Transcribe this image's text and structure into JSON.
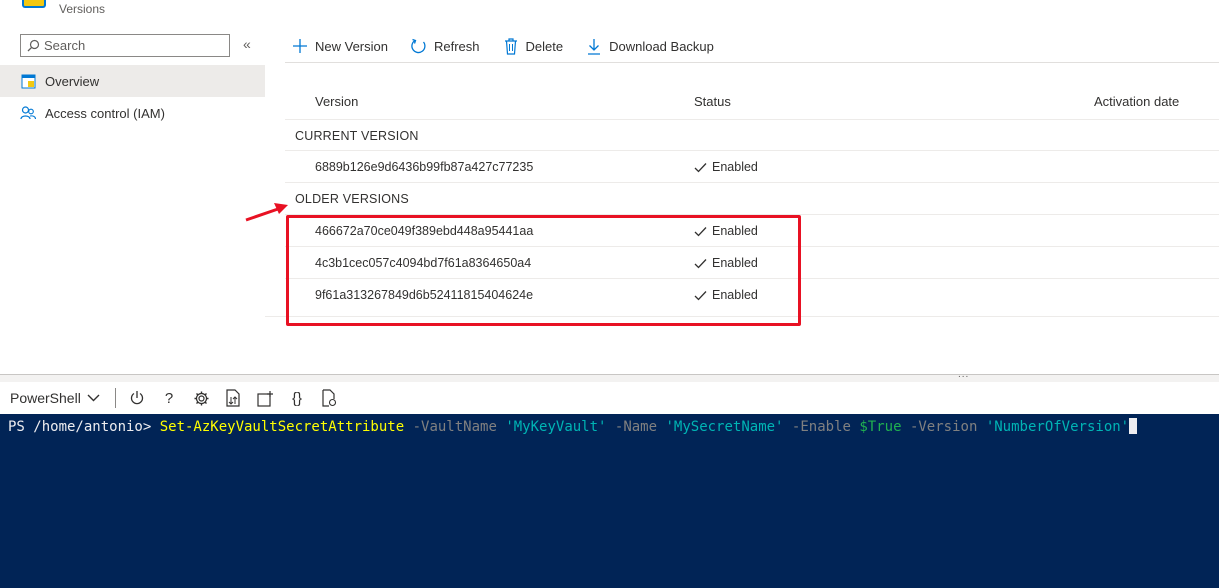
{
  "header": {
    "subtitle": "Versions"
  },
  "sidebar": {
    "search_placeholder": "Search",
    "collapse_glyph": "«",
    "items": [
      {
        "label": "Overview",
        "icon": "overview-icon",
        "active": true
      },
      {
        "label": "Access control (IAM)",
        "icon": "people-icon",
        "active": false
      }
    ]
  },
  "toolbar": {
    "new_version": "New Version",
    "refresh": "Refresh",
    "delete": "Delete",
    "download_backup": "Download Backup"
  },
  "table": {
    "columns": {
      "version": "Version",
      "status": "Status",
      "activation_date": "Activation date"
    },
    "current_section": "CURRENT VERSION",
    "current_rows": [
      {
        "version": "6889b126e9d6436b99fb87a427c77235",
        "status": "Enabled"
      }
    ],
    "older_section": "OLDER VERSIONS",
    "older_rows": [
      {
        "version": "466672a70ce049f389ebd448a95441aa",
        "status": "Enabled"
      },
      {
        "version": "4c3b1cec057c4094bd7f61a8364650a4",
        "status": "Enabled"
      },
      {
        "version": "9f61a313267849d6b52411815404624e",
        "status": "Enabled"
      }
    ]
  },
  "shell": {
    "environment": "PowerShell",
    "toolbar_icons": [
      "power-icon",
      "help-icon",
      "settings-icon",
      "upload-download-icon",
      "new-session-icon",
      "editor-braces-icon",
      "web-preview-icon"
    ],
    "help_glyph": "?",
    "braces_glyph": "{}",
    "prompt": "PS /home/antonio> ",
    "cmdlet": "Set-AzKeyVaultSecretAttribute",
    "p1": " -VaultName ",
    "v1": "'MyKeyVault'",
    "p2": " -Name ",
    "v2": "'MySecretName'",
    "p3": " -Enable ",
    "v3": "$True",
    "p4": " -Version ",
    "v4": "'NumberOfVersion'",
    "splitter_grip": "..."
  },
  "colors": {
    "accent": "#0078d4",
    "highlight": "#e81123",
    "terminal_bg": "#012456"
  }
}
